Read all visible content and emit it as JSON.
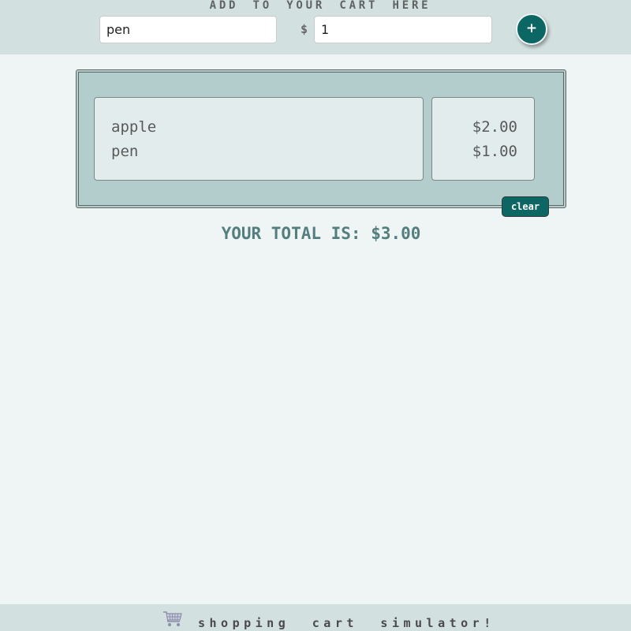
{
  "header": {
    "title": "ADD TO YOUR CART HERE",
    "item_input_value": "pen",
    "currency_symbol": "$",
    "price_input_value": "1",
    "add_button_label": "+"
  },
  "cart": {
    "items": [
      {
        "name": "apple",
        "price": "$2.00"
      },
      {
        "name": "pen",
        "price": "$1.00"
      }
    ],
    "clear_button_label": "clear"
  },
  "total_text": "YOUR TOTAL IS: $3.00",
  "footer": {
    "text": "shopping cart simulator!",
    "icon": "shopping-cart-icon"
  },
  "colors": {
    "accent": "#0c6664",
    "header_bg": "#d2e0e0",
    "page_bg": "#eef5f4",
    "panel_bg": "#b3cdcc",
    "total_text": "#547e7e"
  }
}
